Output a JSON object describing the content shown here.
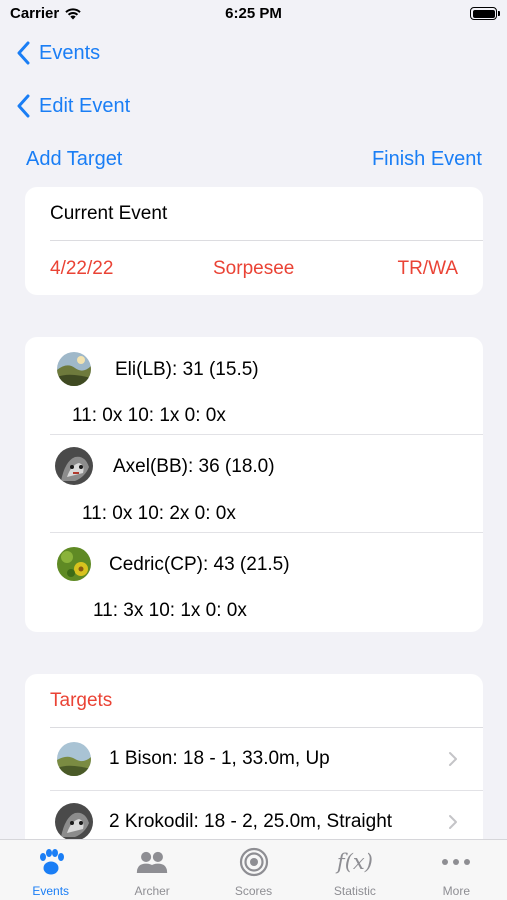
{
  "status_bar": {
    "carrier": "Carrier",
    "time": "6:25 PM"
  },
  "nav": {
    "back_primary": "Events",
    "back_secondary": "Edit Event"
  },
  "toolbar": {
    "add_target": "Add Target",
    "finish_event": "Finish Event"
  },
  "current_event": {
    "title": "Current Event",
    "date": "4/22/22",
    "place": "Sorpesee",
    "type": "TR/WA"
  },
  "archers": [
    {
      "name": "Eli(LB): 31 (15.5)",
      "stats": "11: 0x  10: 1x  0: 0x",
      "avatar": "landscape-avatar"
    },
    {
      "name": "Axel(BB): 36 (18.0)",
      "stats": "11: 0x  10: 2x  0: 0x",
      "avatar": "animal-avatar"
    },
    {
      "name": "Cedric(CP): 43 (21.5)",
      "stats": "11: 3x  10: 1x  0: 0x",
      "avatar": "flower-avatar"
    }
  ],
  "targets": {
    "header": "Targets",
    "items": [
      {
        "label": "1 Bison: 18 - 1, 33.0m, Up"
      },
      {
        "label": "2 Krokodil: 18 - 2, 25.0m, Straight"
      }
    ]
  },
  "tabs": [
    {
      "label": "Events",
      "icon": "paw-icon",
      "active": true
    },
    {
      "label": "Archer",
      "icon": "people-icon",
      "active": false
    },
    {
      "label": "Scores",
      "icon": "target-icon",
      "active": false
    },
    {
      "label": "Statistic",
      "icon": "function-icon",
      "active": false,
      "glyph": "f(x)"
    },
    {
      "label": "More",
      "icon": "more-icon",
      "active": false
    }
  ],
  "colors": {
    "accent": "#1a7ef5",
    "highlight": "#ea4335",
    "background": "#f2f2f7"
  }
}
